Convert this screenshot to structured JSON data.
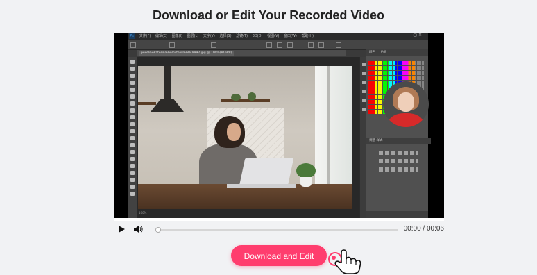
{
  "header": {
    "title": "Download or Edit Your Recorded Video"
  },
  "editor": {
    "menu_items": [
      "文件(F)",
      "编辑(E)",
      "图像(I)",
      "图层(L)",
      "文字(Y)",
      "选择(S)",
      "滤镜(T)",
      "3D(D)",
      "视图(V)",
      "窗口(W)",
      "帮助(H)"
    ],
    "document_tab": "pexels-ekaterina-bolovtsova-6049992.jpg @ 100%(RGB/8)",
    "panel_tabs_top": [
      "颜色",
      "色板"
    ],
    "panel_tabs_mid": [
      "调整",
      "样式"
    ],
    "status": "100%"
  },
  "player": {
    "time": "00:00 / 00:06",
    "progress": 0.0
  },
  "actions": {
    "download_label": "Download and Edit"
  },
  "colors": {
    "accent": "#ff3d6e",
    "page_bg": "#f1f2f4"
  }
}
